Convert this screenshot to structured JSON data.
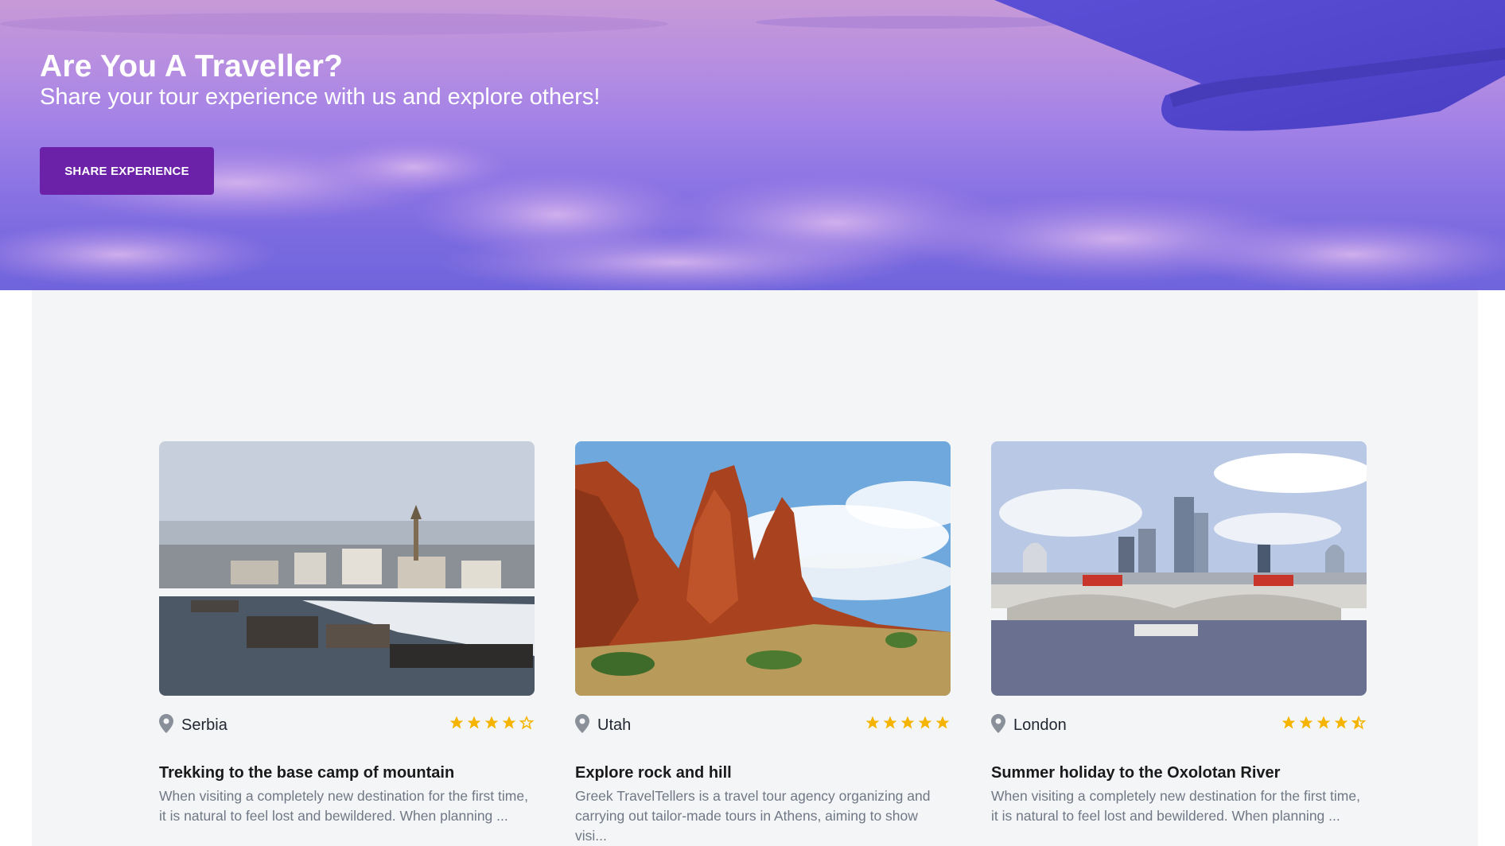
{
  "hero": {
    "title": "Are You A Traveller?",
    "subtitle": "Share your tour experience with us and explore others!",
    "button_label": "SHARE EXPERIENCE"
  },
  "colors": {
    "button": "#6b21a8",
    "star": "#f5b400",
    "content_bg": "#f4f5f7",
    "pin": "#8a9099"
  },
  "cards": [
    {
      "location": "Serbia",
      "rating": 3.5,
      "rating_display": "3 full stars, 1 half, 1 empty",
      "title": "Trekking to the base camp of mountain",
      "description": "When visiting a completely new destination for the first time, it is natural to feel lost and bewildered. When planning ..."
    },
    {
      "location": "Utah",
      "rating": 5,
      "title": "Explore rock and hill",
      "description": "Greek TravelTellers is a travel tour agency organizing and carrying out tailor-made tours in Athens, aiming to show visi..."
    },
    {
      "location": "London",
      "rating": 4.5,
      "title": "Summer holiday to the Oxolotan River",
      "description": "When visiting a completely new destination for the first time, it is natural to feel lost and bewildered. When planning ..."
    }
  ]
}
